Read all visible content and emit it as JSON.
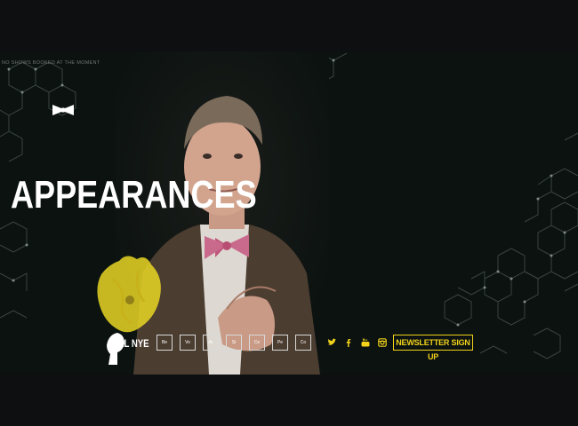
{
  "header": {
    "tour_notice": "NO SHOWS BOOKED AT THE MOMENT"
  },
  "hero": {
    "title": "APPEARANCES"
  },
  "logo": {
    "text": "BILL NYE"
  },
  "elements": [
    {
      "symbol": "Be"
    },
    {
      "symbol": "Vo"
    },
    {
      "symbol": "Ar"
    },
    {
      "symbol": "Si"
    },
    {
      "symbol": "Ce"
    },
    {
      "symbol": "Pe"
    },
    {
      "symbol": "Co"
    }
  ],
  "social": {
    "icons": [
      "twitter-icon",
      "facebook-icon",
      "youtube-icon",
      "instagram-icon"
    ]
  },
  "newsletter": {
    "label": "NEWSLETTER SIGN UP"
  },
  "colors": {
    "accent": "#f2d21b",
    "background": "#0d0f10",
    "band": "#0b1210",
    "hex_lines": "#3a4440"
  }
}
